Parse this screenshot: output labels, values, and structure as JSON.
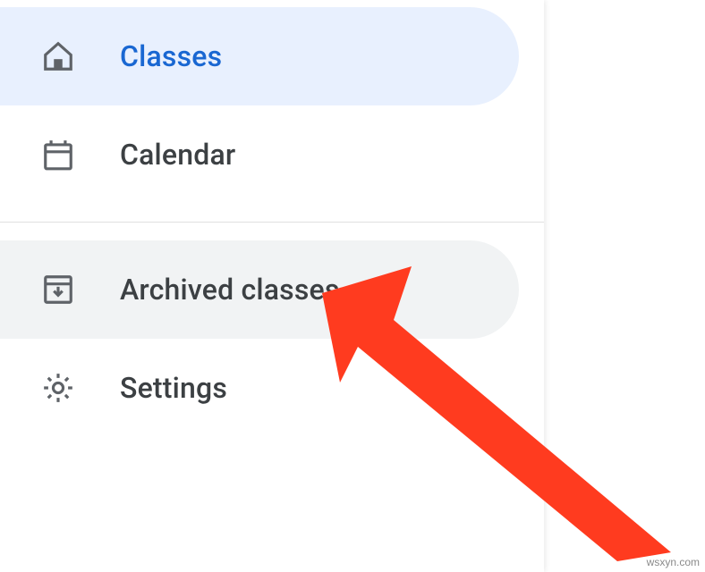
{
  "sidebar": {
    "items": [
      {
        "label": "Classes"
      },
      {
        "label": "Calendar"
      },
      {
        "label": "Archived classes"
      },
      {
        "label": "Settings"
      }
    ]
  },
  "watermark": "wsxyn.com",
  "colors": {
    "active_bg": "#e8f0fe",
    "active_fg": "#1967d2",
    "hover_bg": "#f1f3f4",
    "text": "#3c4043",
    "arrow": "#ff3b1f"
  }
}
